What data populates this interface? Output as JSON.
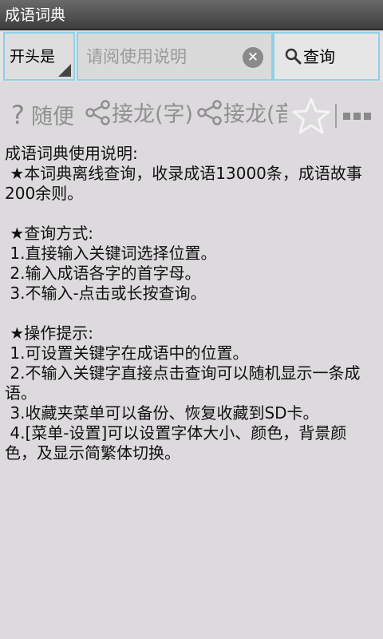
{
  "app": {
    "title": "成语词典"
  },
  "search": {
    "mode_label": "开头是",
    "placeholder": "请阅使用说明",
    "button_label": "查询"
  },
  "toolbar": {
    "random_label": "随便",
    "chain_char_label": "接龙(字)",
    "chain_sound_label": "接龙(音"
  },
  "content": {
    "title": "成语词典使用说明:",
    "intro": " ★本词典离线查询，收录成语13000条，成语故事200余则。",
    "query_heading": " ★查询方式:",
    "query_items": [
      " 1.直接输入关键词选择位置。",
      " 2.输入成语各字的首字母。",
      " 3.不输入-点击或长按查询。"
    ],
    "tips_heading": " ★操作提示:",
    "tips_items": [
      " 1.可设置关键字在成语中的位置。",
      " 2.不输入关键字直接点击查询可以随机显示一条成语。",
      " 3.收藏夹菜单可以备份、恢复收藏到SD卡。",
      " 4.[菜单-设置]可以设置字体大小、颜色，背景颜色，及显示简繁体切换。"
    ]
  },
  "colors": {
    "titlebar": "#4e4e4e",
    "field_border": "#8ed0e8",
    "background": "#dcdadc",
    "toolbar_text": "#909090"
  },
  "icons": [
    "question-icon",
    "share-icon",
    "star-icon",
    "overflow-menu-icon",
    "search-icon",
    "clear-icon",
    "dropdown-triangle-icon"
  ]
}
